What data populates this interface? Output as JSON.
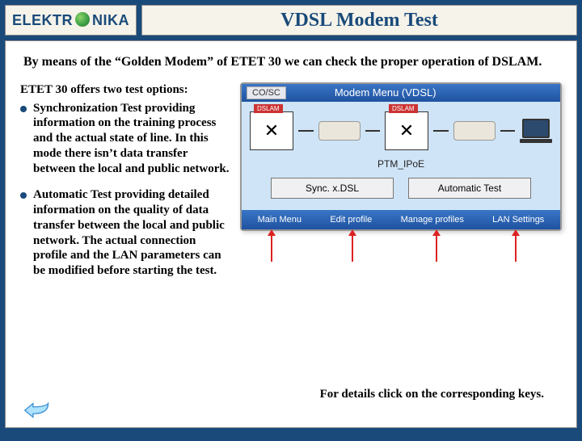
{
  "header": {
    "logo_left": "ELEKTR",
    "logo_right": "NIKA",
    "title": "VDSL Modem Test"
  },
  "intro": "By means of the “Golden Modem” of ETET 30 we can check the proper operation of DSLAM.",
  "lead": "ETET 30 offers two test options:",
  "bullets": [
    "Synchronization Test providing information on the training process and the actual state of line. In this mode there isn’t data transfer between the local and public network.",
    "Automatic Test providing detailed information on the quality of data transfer between the local and public network. The actual connection profile and the LAN parameters can be modified before starting the test."
  ],
  "panel": {
    "cosc": "CO/SC",
    "menu_title": "Modem Menu (VDSL)",
    "dslam": "DSLAM",
    "ptm": "PTM_IPoE",
    "btn_sync": "Sync. x.DSL",
    "btn_auto": "Automatic Test",
    "bottom": {
      "main": "Main Menu",
      "edit": "Edit profile",
      "manage": "Manage profiles",
      "lan": "LAN Settings"
    }
  },
  "footer_hint": "For details click on the corresponding keys."
}
